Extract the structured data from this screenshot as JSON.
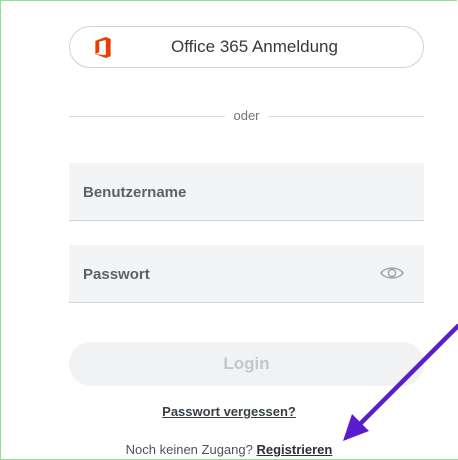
{
  "office_button": {
    "label": "Office 365 Anmeldung",
    "icon": "office-365-icon",
    "icon_color": "#eb3c00"
  },
  "divider": {
    "label": "oder"
  },
  "username": {
    "placeholder": "Benutzername",
    "value": ""
  },
  "password": {
    "placeholder": "Passwort",
    "value": "",
    "toggle_icon": "eye-icon"
  },
  "login": {
    "label": "Login",
    "enabled": false
  },
  "forgot_password": {
    "label": "Passwort vergessen?"
  },
  "no_account": {
    "prefix": "Noch keinen Zugang?",
    "register_label": "Registrieren"
  },
  "annotation": {
    "type": "arrow",
    "color": "#5a1ccc"
  }
}
